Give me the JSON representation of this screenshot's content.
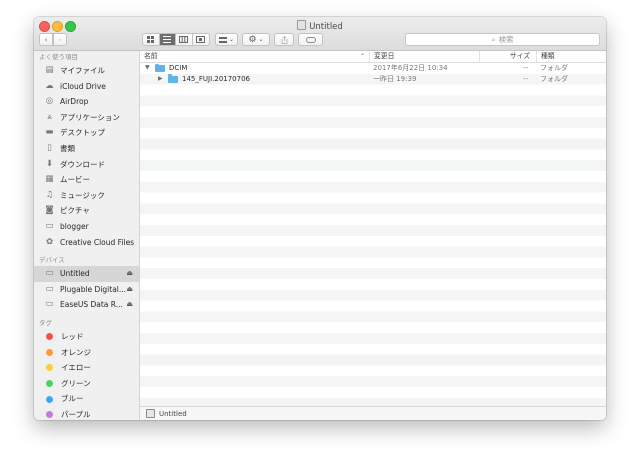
{
  "window": {
    "title": "Untitled"
  },
  "toolbar": {
    "back": "‹",
    "forward": "›",
    "view_modes": [
      "icon",
      "list",
      "column",
      "cover-flow"
    ],
    "search_placeholder": "検索"
  },
  "sidebar": {
    "favorites_header": "よく使う項目",
    "favorites": [
      {
        "label": "マイファイル",
        "icon": "all-my-files-icon"
      },
      {
        "label": "iCloud Drive",
        "icon": "cloud-icon"
      },
      {
        "label": "AirDrop",
        "icon": "airdrop-icon"
      },
      {
        "label": "アプリケーション",
        "icon": "applications-icon"
      },
      {
        "label": "デスクトップ",
        "icon": "desktop-icon"
      },
      {
        "label": "書類",
        "icon": "documents-icon"
      },
      {
        "label": "ダウンロード",
        "icon": "download-icon"
      },
      {
        "label": "ムービー",
        "icon": "movies-icon"
      },
      {
        "label": "ミュージック",
        "icon": "music-icon"
      },
      {
        "label": "ピクチャ",
        "icon": "camera-icon"
      },
      {
        "label": "blogger",
        "icon": "folder-icon"
      },
      {
        "label": "Creative Cloud Files",
        "icon": "creative-cloud-icon"
      }
    ],
    "devices_header": "デバイス",
    "devices": [
      {
        "label": "Untitled",
        "icon": "drive-icon",
        "selected": true
      },
      {
        "label": "Plugable Digital...",
        "icon": "drive-icon"
      },
      {
        "label": "EaseUS Data R...",
        "icon": "drive-icon"
      }
    ],
    "tags_header": "タグ",
    "tags": [
      {
        "label": "レッド",
        "color": "#fc4e4a"
      },
      {
        "label": "オレンジ",
        "color": "#fd9a3a"
      },
      {
        "label": "イエロー",
        "color": "#fccb3f"
      },
      {
        "label": "グリーン",
        "color": "#4cd263"
      },
      {
        "label": "ブルー",
        "color": "#3da8f4"
      },
      {
        "label": "パープル",
        "color": "#c17bdc"
      }
    ]
  },
  "columns": {
    "name": "名前",
    "modified": "変更日",
    "size": "サイズ",
    "kind": "種類"
  },
  "files": [
    {
      "name": "DCIM",
      "modified": "2017年6月22日 10:34",
      "size": "--",
      "kind": "フォルダ",
      "expanded": true
    },
    {
      "name": "145_FUJI.20170706",
      "modified": "一昨日 19:39",
      "size": "--",
      "kind": "フォルダ",
      "expanded": false
    }
  ],
  "pathbar": {
    "label": "Untitled"
  }
}
